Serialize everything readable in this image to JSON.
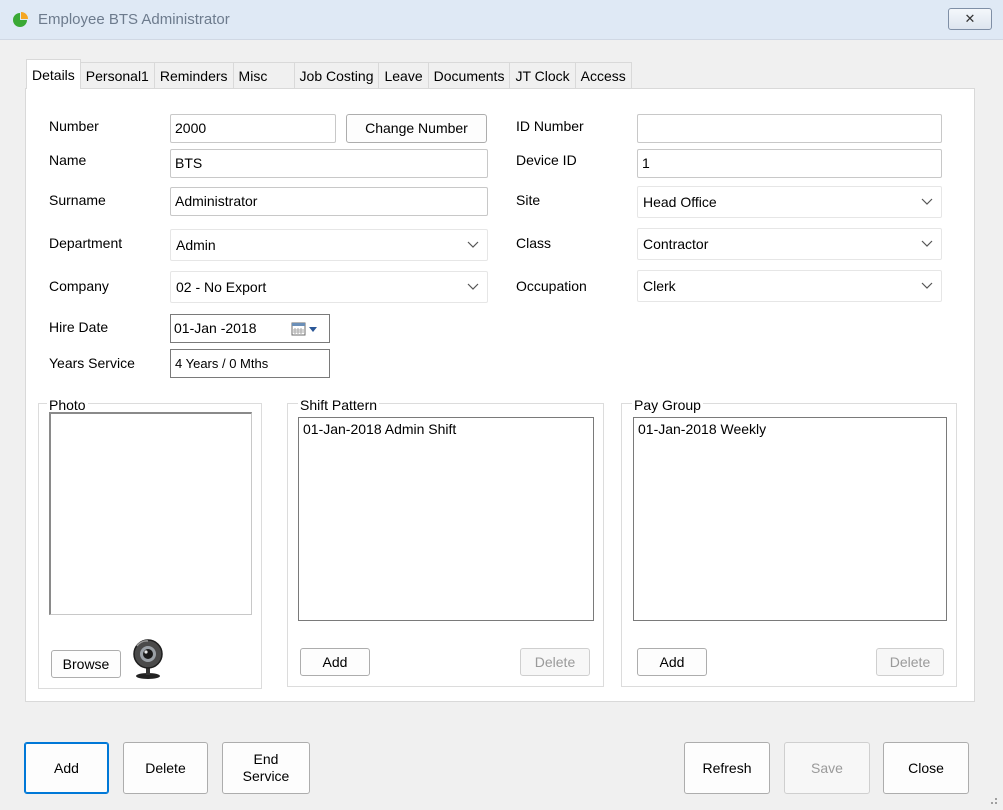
{
  "window": {
    "title": "Employee BTS Administrator",
    "close_glyph": "✕"
  },
  "tabs": [
    "Details",
    "Personal1",
    "Reminders",
    "Misc",
    "Job Costing",
    "Leave",
    "Documents",
    "JT Clock",
    "Access"
  ],
  "active_tab": "Details",
  "form": {
    "number_label": "Number",
    "number_value": "2000",
    "change_number_label": "Change Number",
    "name_label": "Name",
    "name_value": "BTS",
    "surname_label": "Surname",
    "surname_value": "Administrator",
    "department_label": "Department",
    "department_value": "Admin",
    "company_label": "Company",
    "company_value": "02 - No Export",
    "hire_date_label": "Hire Date",
    "hire_date_value": "01-Jan -2018",
    "years_service_label": "Years Service",
    "years_service_value": "4 Years / 0 Mths",
    "id_number_label": "ID Number",
    "id_number_value": "",
    "device_id_label": "Device ID",
    "device_id_value": "1",
    "site_label": "Site",
    "site_value": "Head Office",
    "class_label": "Class",
    "class_value": "Contractor",
    "occupation_label": "Occupation",
    "occupation_value": "Clerk"
  },
  "photo": {
    "legend": "Photo",
    "browse_label": "Browse"
  },
  "shift_pattern": {
    "legend": "Shift Pattern",
    "items": [
      "01-Jan-2018 Admin Shift"
    ],
    "add_label": "Add",
    "delete_label": "Delete"
  },
  "pay_group": {
    "legend": "Pay Group",
    "items": [
      "01-Jan-2018 Weekly"
    ],
    "add_label": "Add",
    "delete_label": "Delete"
  },
  "footer": {
    "add_label": "Add",
    "delete_label": "Delete",
    "end_service_line1": "End",
    "end_service_line2": "Service",
    "refresh_label": "Refresh",
    "save_label": "Save",
    "close_label": "Close"
  },
  "colors": {
    "accent": "#0078d7",
    "titlebar": "#dfe9f5",
    "icon_green": "#3aa935",
    "icon_orange": "#f5a623"
  }
}
